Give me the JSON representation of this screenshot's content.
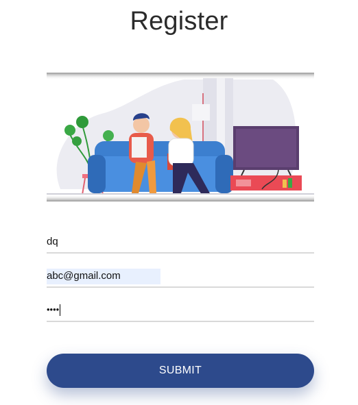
{
  "page": {
    "title": "Register"
  },
  "hero": {
    "illustration": "couple-watching-tv-illustration"
  },
  "form": {
    "name_value": "dq",
    "email_value": "abc@gmail.com",
    "password_mask": "••••",
    "submit_label": "SUBMIT"
  },
  "colors": {
    "accent": "#2d4a8c",
    "autofill": "#e8f0fe",
    "underline": "#d9d9d9"
  }
}
